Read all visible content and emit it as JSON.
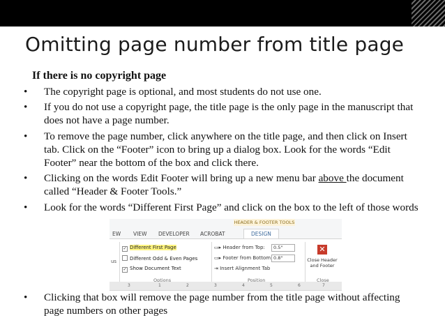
{
  "title": "Omitting page number from title page",
  "subheading": "If there is no copyright page",
  "bullets": {
    "b1": "The copyright page is optional, and most students do not use one.",
    "b2": "If you do not use a copyright page, the title page is the only page in the manuscript that does not have a page number.",
    "b3": "To remove the page number, click anywhere on the title page, and then click on Insert tab. Click on the “Footer” icon to bring up a dialog  box. Look for the words “Edit Footer” near the bottom of the box and click there.",
    "b4_pre": "Clicking on the words  Edit Footer will bring up a new menu bar ",
    "b4_underlined": "above ",
    "b4_post": "the document called “Header & Footer Tools.”",
    "b5": "Look for the words “Different First Page” and click on the box to the left of those words",
    "b6": "Clicking that box will remove the page number from the title page without affecting page numbers on other pages",
    "bullet_glyph": "•"
  },
  "ribbon": {
    "context_header": "HEADER & FOOTER TOOLS",
    "tabs": [
      "EW",
      "VIEW",
      "DEVELOPER",
      "ACROBAT",
      "DESIGN"
    ],
    "options": {
      "different_first_page": "Different First Page",
      "different_odd_even": "Different Odd & Even Pages",
      "show_document_text": "Show Document Text",
      "group_label": "Options"
    },
    "position": {
      "header_from_top_label": "Header from Top:",
      "header_from_top_value": "0.5\"",
      "footer_from_bottom_label": "Footer from Bottom:",
      "footer_from_bottom_value": "0.8\"",
      "insert_alignment_tab": "Insert Alignment Tab",
      "group_label": "Position"
    },
    "close": {
      "label_line1": "Close Header",
      "label_line2": "and Footer",
      "group_label": "Close"
    },
    "left_fragment": "us",
    "ruler_marks": [
      "3",
      "1",
      "2",
      "3",
      "4",
      "5",
      "6",
      "7"
    ]
  },
  "colors": {
    "top_bar": "#000000",
    "highlight": "#fff580",
    "close_icon": "#c73b2b",
    "active_tab_text": "#3d6a9c"
  }
}
